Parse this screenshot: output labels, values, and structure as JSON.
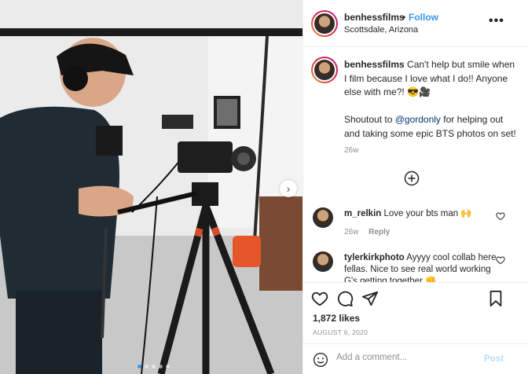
{
  "header": {
    "username": "benhessfilms",
    "separator": "•",
    "follow_label": "Follow",
    "location": "Scottsdale, Arizona",
    "more_icon": "more-horizontal-icon"
  },
  "caption": {
    "username": "benhessfilms",
    "line1": "Can't help but smile when I film because I love what I do!! Anyone else with me?! 😎🎥",
    "shoutout_prefix": "Shoutout to ",
    "mention": "@gordonly",
    "shoutout_suffix": " for helping out and taking some epic BTS photos on set!",
    "time": "26w"
  },
  "comments": [
    {
      "username": "m_relkin",
      "text": "Love your bts man 🙌",
      "time": "26w",
      "reply_label": "Reply"
    },
    {
      "username": "tylerkirkphoto",
      "text": "Ayyyy cool collab here fellas. Nice to see real world working G's getting together 👊",
      "time": "",
      "reply_label": ""
    }
  ],
  "likes": "1,872 likes",
  "date": "AUGUST 6, 2020",
  "add_comment": {
    "placeholder": "Add a comment...",
    "post_label": "Post"
  },
  "carousel": {
    "total": 5,
    "active": 1
  },
  "colors": {
    "accent": "#3897f0",
    "mention": "#00376b",
    "muted": "#8e8e8e",
    "post_disabled": "#b2dffc"
  }
}
